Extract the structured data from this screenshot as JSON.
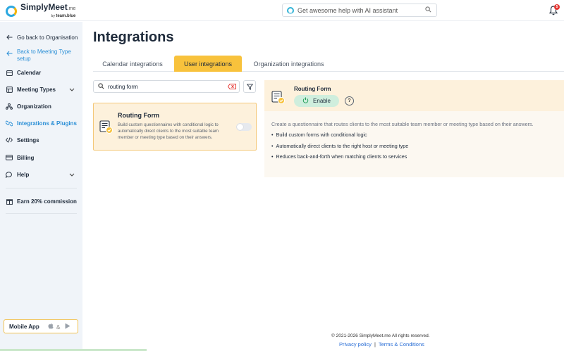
{
  "app": {
    "brand": "SimplyMeet",
    "brand_suffix": ".me",
    "by_line": "by",
    "by_brand": "team.blue"
  },
  "header": {
    "ai_search_placeholder": "Get awesome help with AI assistant",
    "notification_count": "5"
  },
  "sidebar": {
    "items": [
      {
        "label": "Go back to Organisation",
        "icon": "arrow-left-icon"
      },
      {
        "label": "Back to Meeting Type setup",
        "icon": "arrow-left-icon"
      },
      {
        "label": "Calendar",
        "icon": "calendar-icon"
      },
      {
        "label": "Meeting Types",
        "icon": "meeting-types-icon"
      },
      {
        "label": "Organization",
        "icon": "organization-icon"
      },
      {
        "label": "Integrations & Plugins",
        "icon": "integrations-icon"
      },
      {
        "label": "Settings",
        "icon": "code-icon"
      },
      {
        "label": "Billing",
        "icon": "billing-icon"
      },
      {
        "label": "Help",
        "icon": "help-chat-icon"
      },
      {
        "label": "Earn 20% commission",
        "icon": "gift-icon"
      }
    ],
    "mobile_app_label": "Mobile App",
    "mobile_app_and": "&"
  },
  "main": {
    "title": "Integrations",
    "tabs": [
      {
        "label": "Calendar integrations",
        "active": false
      },
      {
        "label": "User integrations",
        "active": true
      },
      {
        "label": "Organization integrations",
        "active": false
      }
    ],
    "search_value": "routing form"
  },
  "card": {
    "title": "Routing Form",
    "description": "Build custom questionnaires with conditional logic to automatically direct clients to the most suitable team member or meeting type based on their answers.",
    "enabled": false
  },
  "detail": {
    "title": "Routing Form",
    "enable_label": "Enable",
    "intro": "Create a questionnaire that routes clients to the most suitable team member or meeting type based on their answers.",
    "bullets": [
      "Build custom forms with conditional logic",
      "Automatically direct clients to the right host or meeting type",
      "Reduces back-and-forth when matching clients to services"
    ]
  },
  "footer": {
    "copyright": "© 2021-2026 SimplyMeet.me All rights reserved.",
    "privacy": "Privacy policy",
    "separator": "|",
    "terms": "Terms & Conditions"
  },
  "colors": {
    "accent": "#f8c23c",
    "link": "#2b8fd6",
    "enable_bg": "#cfeedd",
    "card_bg": "#fdf1dc"
  }
}
